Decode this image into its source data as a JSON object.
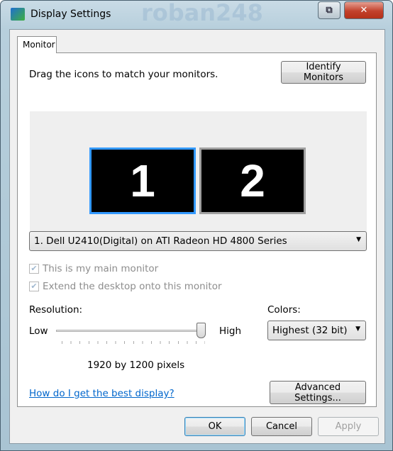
{
  "window": {
    "title": "Display Settings",
    "watermark": "roban248",
    "restore_icon": "restore-icon",
    "close_icon": "close-icon"
  },
  "tabs": [
    {
      "label": "Monitor",
      "selected": true
    }
  ],
  "monitor": {
    "instruction": "Drag the icons to match your monitors.",
    "identify_label": "Identify Monitors",
    "monitors": [
      {
        "label": "1",
        "selected": true
      },
      {
        "label": "2",
        "selected": false
      }
    ],
    "accent": "#3399ff",
    "monitor_select": "1. Dell U2410(Digital) on ATI Radeon HD 4800 Series",
    "main_monitor": {
      "label": "This is my main monitor",
      "checked": true,
      "disabled": true
    },
    "extend": {
      "label": "Extend the desktop onto this monitor",
      "checked": true,
      "disabled": true
    },
    "resolution": {
      "label": "Resolution:",
      "low": "Low",
      "high": "High",
      "value_text": "1920 by 1200 pixels",
      "slider_fraction": 1.0
    },
    "colors": {
      "label": "Colors:",
      "value": "Highest (32 bit)"
    },
    "help_link": "How do I get the best display?",
    "advanced_label": "Advanced Settings..."
  },
  "footer": {
    "ok": "OK",
    "cancel": "Cancel",
    "apply": "Apply"
  }
}
